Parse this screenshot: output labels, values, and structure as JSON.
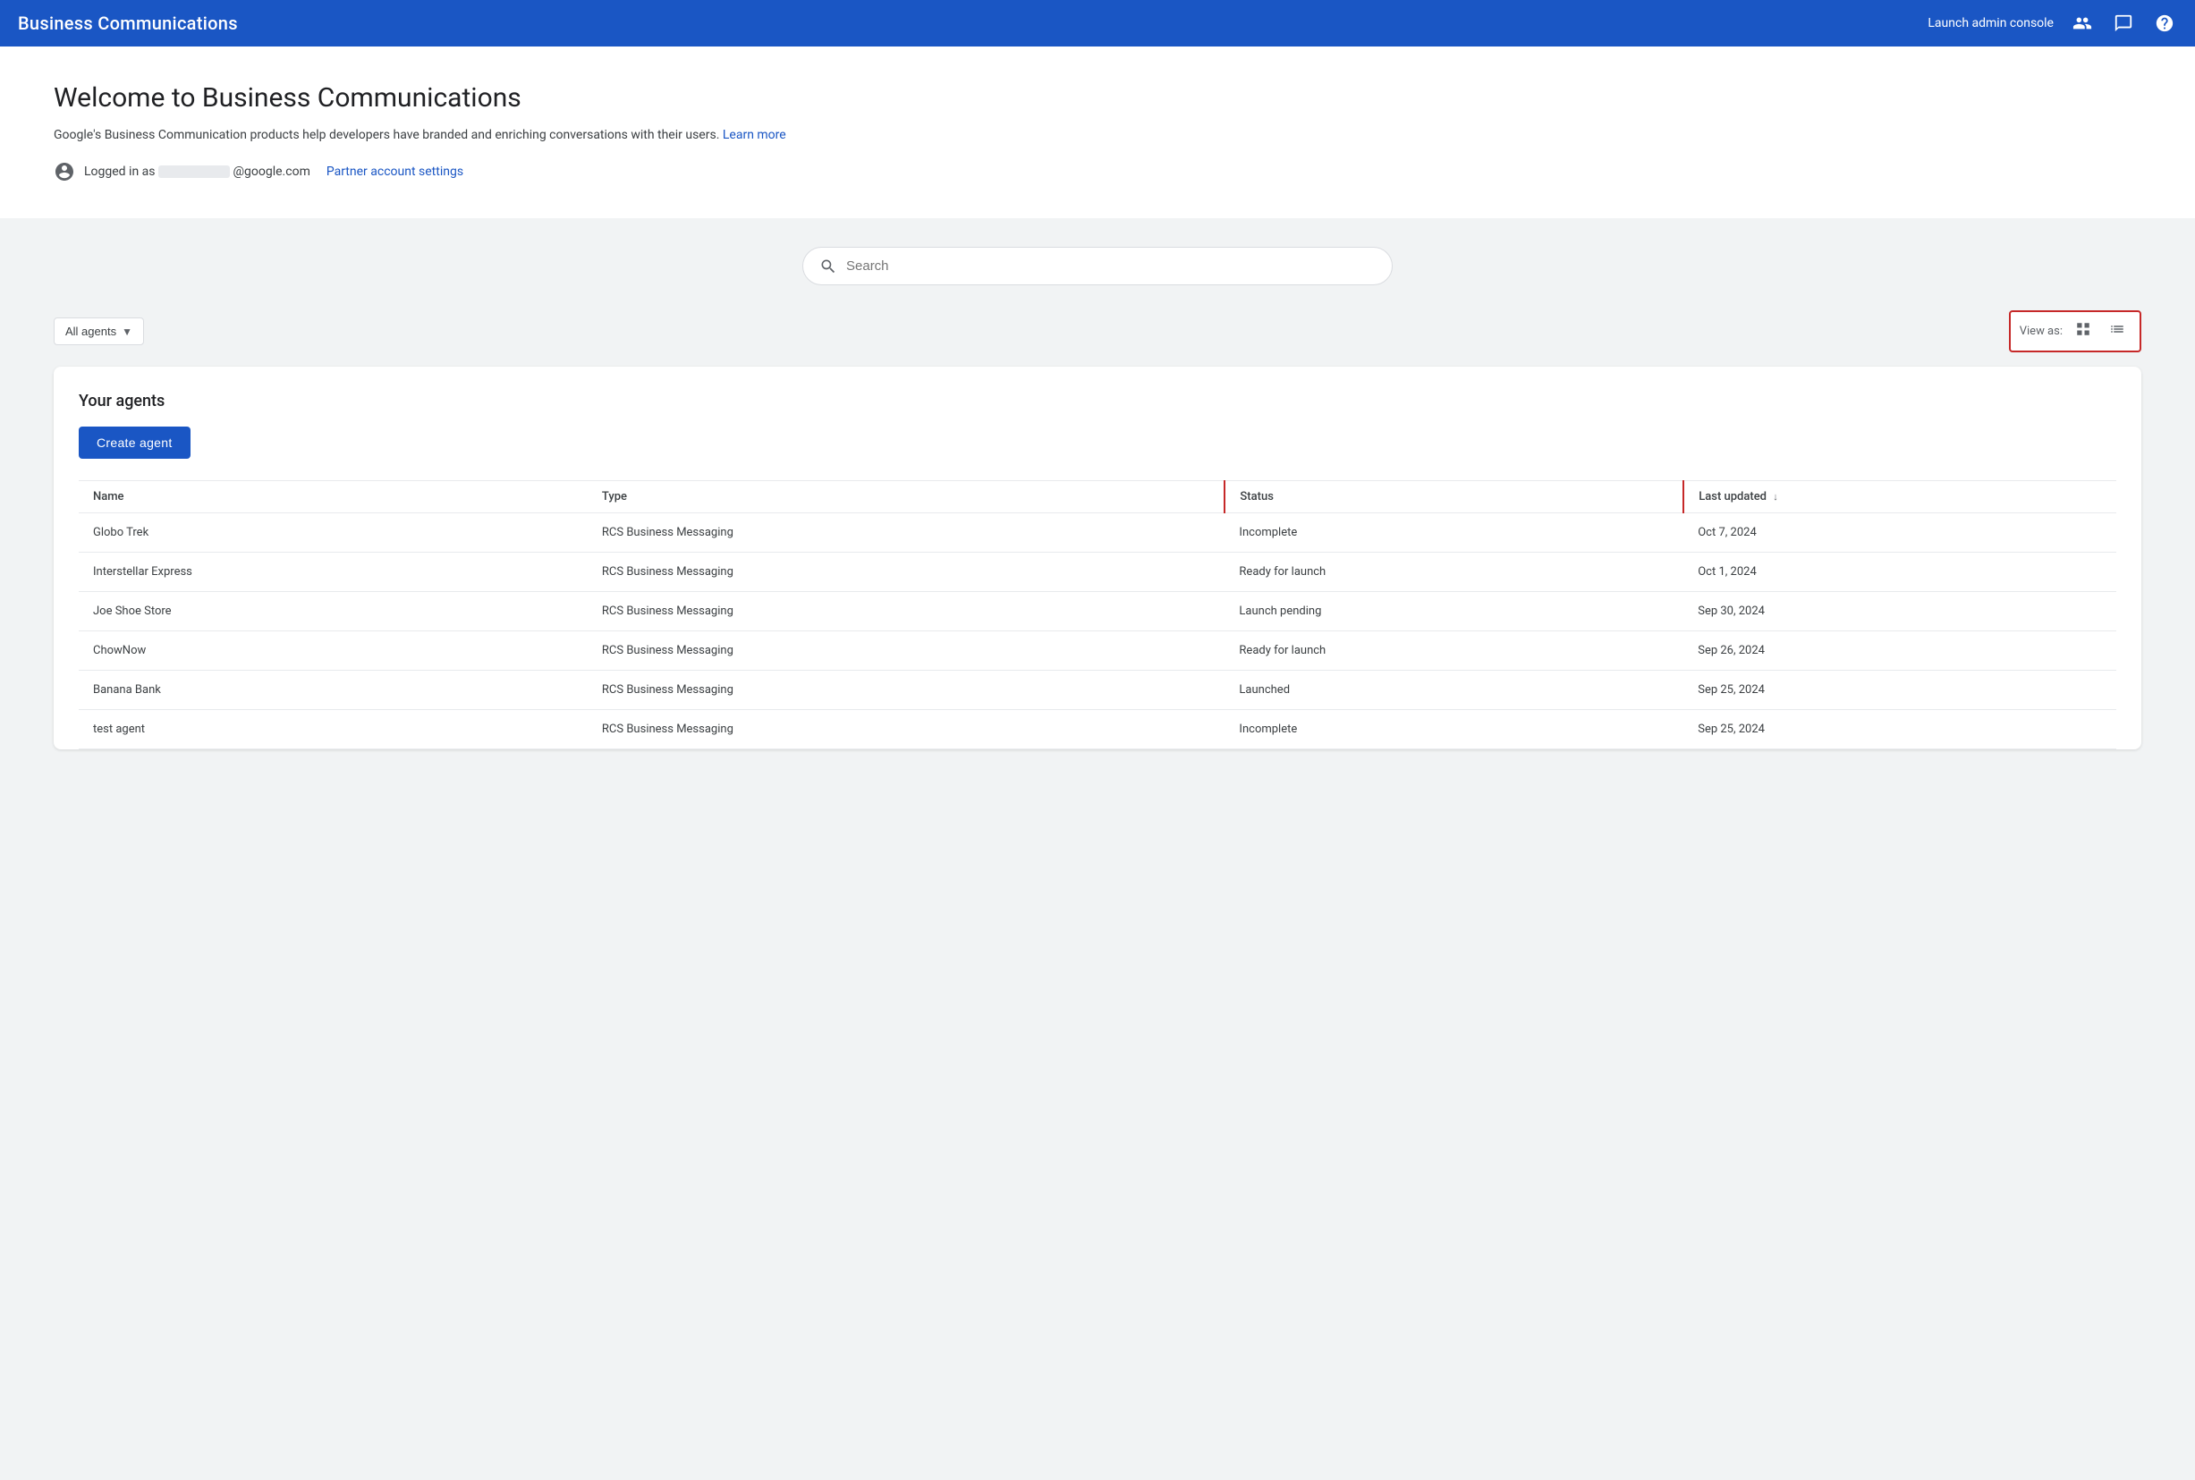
{
  "header": {
    "title": "Business Communications",
    "launch_admin": "Launch admin console",
    "icons": [
      "people-icon",
      "chat-icon",
      "help-icon"
    ]
  },
  "welcome": {
    "title": "Welcome to Business Communications",
    "description": "Google's Business Communication products help developers have branded and enriching conversations with their users.",
    "learn_more_label": "Learn more",
    "logged_in_prefix": "Logged in as",
    "email_domain": "@google.com",
    "partner_settings_label": "Partner account settings"
  },
  "search": {
    "placeholder": "Search"
  },
  "filter": {
    "all_agents_label": "All agents",
    "view_as_label": "View as:"
  },
  "agents_panel": {
    "title": "Your agents",
    "create_button_label": "Create agent",
    "table": {
      "columns": [
        "Name",
        "Type",
        "Status",
        "Last updated"
      ],
      "rows": [
        {
          "name": "Globo Trek",
          "type": "RCS Business Messaging",
          "status": "Incomplete",
          "last_updated": "Oct 7, 2024"
        },
        {
          "name": "Interstellar Express",
          "type": "RCS Business Messaging",
          "status": "Ready for launch",
          "last_updated": "Oct 1, 2024"
        },
        {
          "name": "Joe Shoe Store",
          "type": "RCS Business Messaging",
          "status": "Launch pending",
          "last_updated": "Sep 30, 2024"
        },
        {
          "name": "ChowNow",
          "type": "RCS Business Messaging",
          "status": "Ready for launch",
          "last_updated": "Sep 26, 2024"
        },
        {
          "name": "Banana Bank",
          "type": "RCS Business Messaging",
          "status": "Launched",
          "last_updated": "Sep 25, 2024"
        },
        {
          "name": "test agent",
          "type": "RCS Business Messaging",
          "status": "Incomplete",
          "last_updated": "Sep 25, 2024"
        }
      ]
    }
  },
  "colors": {
    "brand_blue": "#1a56c4",
    "highlight_red": "#c62828"
  }
}
